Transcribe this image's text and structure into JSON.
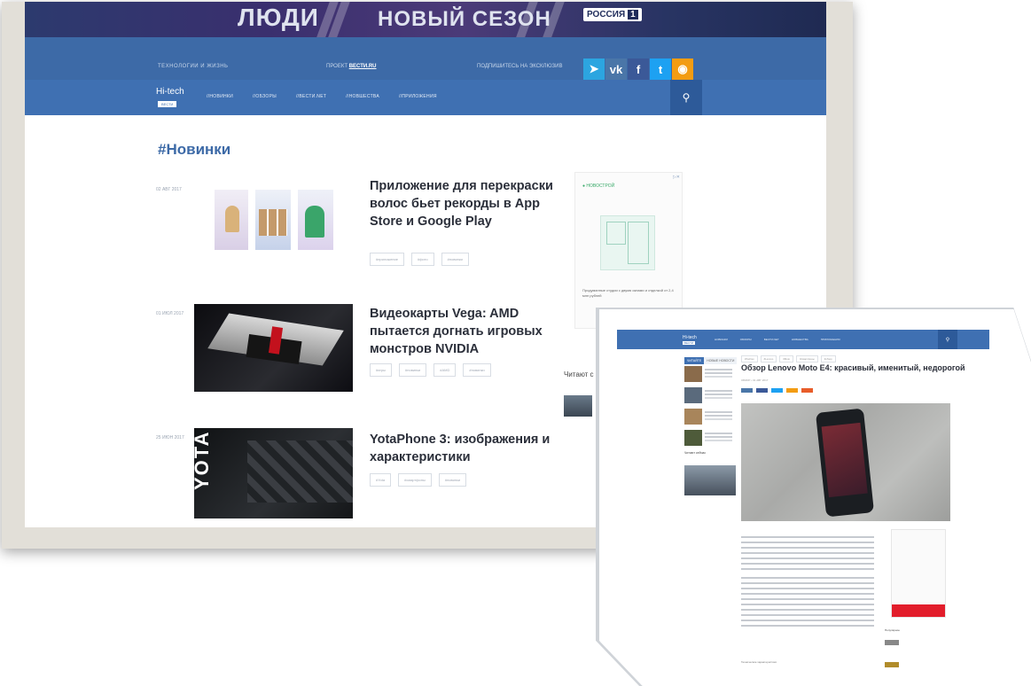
{
  "banner": {
    "title_left": "ЛЮДИ",
    "title_right": "НОВЫЙ СЕЗОН",
    "channel": "РОССИЯ",
    "channel_num": "1"
  },
  "topbar": {
    "left_text": "ТЕХНОЛОГИИ И ЖИЗНЬ",
    "project_label": "ПРОЕКТ",
    "project_link": "ВЕСТИ.RU",
    "subscribe_text": "ПОДПИШИТЕСЬ НА ЭКСКЛЮЗИВ",
    "socials": [
      "telegram",
      "vk",
      "facebook",
      "twitter",
      "rss"
    ]
  },
  "nav": {
    "brand": "Hi-tech",
    "brand_sub": "ВЕСТИ",
    "items": [
      "//НОВИНКИ",
      "//ОБЗОРЫ",
      "//ВЕСТИ.NET",
      "//НОВШЕСТВА",
      "//ПРИЛОЖЕНИЯ"
    ]
  },
  "section_title": "#Новинки",
  "articles": [
    {
      "date": "02 АВГ 2017",
      "title": "Приложение для перекраски волос бьет рекорды в App Store и Google Play",
      "tags": [
        "#приложение",
        "#фото",
        "#новинки"
      ]
    },
    {
      "date": "01 ИЮЛ 2017",
      "title": "Видеокарты Vega: AMD пытается догнать игровых монстров NVIDIA",
      "tags": [
        "#игры",
        "#новинки",
        "#AMD",
        "#новинки"
      ]
    },
    {
      "date": "25 ИЮН 2017",
      "title": "YotaPhone 3: изображения и характеристики",
      "tags": [
        "#Yota",
        "#смартфоны",
        "#новинки"
      ]
    }
  ],
  "ad": {
    "badge": "▷✕",
    "brand": "● НОВОСТРОЙ",
    "text": "Продуманные студии с двумя окнами и отделкой от 2,4 млн рублей"
  },
  "sidebar": {
    "reading_label": "Читают с"
  },
  "inset": {
    "nav_brand": "Hi-tech",
    "nav_brand_sub": "ВЕСТИ",
    "nav_items": [
      "НОВИНКИ",
      "ОБЗОРЫ",
      "ВЕСТИ.NET",
      "НОВШЕСТВА",
      "ПРИЛОЖЕНИЯ"
    ],
    "tabs": [
      "ЧИТАЙТЕ",
      "НОВЫЕ НОВОСТИ"
    ],
    "reading_label": "Читают сейчас",
    "crumbs": [
      "#Хайтек",
      "#Lenovo",
      "#Moto",
      "#смартфоны",
      "#обзор"
    ],
    "title": "Обзор Lenovo Moto E4: красивый, именитый, недорогой",
    "meta": "ОБЗОР  •  01 АВГ 2017",
    "footer_label": "Технические характеристики",
    "popular_label": "Популярное"
  }
}
